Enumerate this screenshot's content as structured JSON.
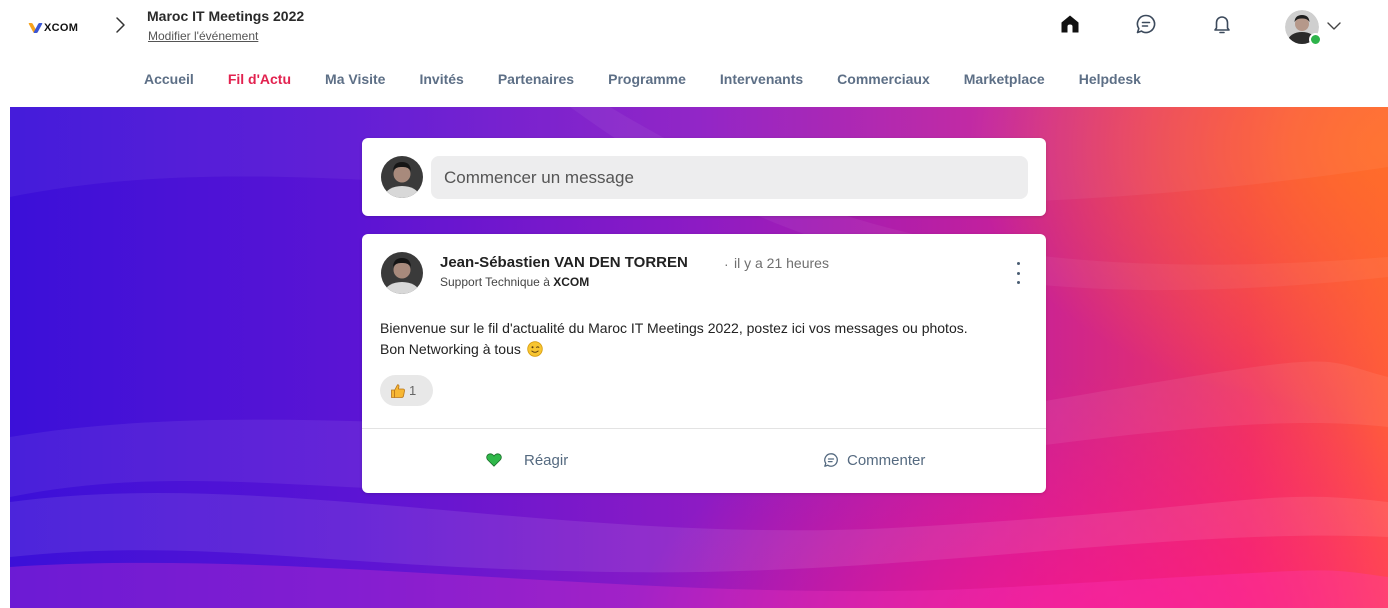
{
  "brand": {
    "logo_text": "XCOM"
  },
  "event": {
    "title": "Maroc IT Meetings 2022",
    "edit_link": "Modifier l'événement"
  },
  "nav": {
    "items": [
      {
        "label": "Accueil",
        "active": false
      },
      {
        "label": "Fil d'Actu",
        "active": true
      },
      {
        "label": "Ma Visite",
        "active": false
      },
      {
        "label": "Invités",
        "active": false
      },
      {
        "label": "Partenaires",
        "active": false
      },
      {
        "label": "Programme",
        "active": false
      },
      {
        "label": "Intervenants",
        "active": false
      },
      {
        "label": "Commerciaux",
        "active": false
      },
      {
        "label": "Marketplace",
        "active": false
      },
      {
        "label": "Helpdesk",
        "active": false
      }
    ]
  },
  "composer": {
    "placeholder": "Commencer un message"
  },
  "post": {
    "author": "Jean-Sébastien VAN DEN TORREN",
    "separator": "·",
    "time": "il y a 21 heures",
    "role_prefix": "Support Technique à",
    "company": "XCOM",
    "body_line1": "Bienvenue sur le fil d'actualité du Maroc IT Meetings 2022, postez ici vos messages ou photos.",
    "body_line2": "Bon Networking à tous",
    "reaction_count": "1",
    "react_label": "Réagir",
    "comment_label": "Commenter"
  },
  "colors": {
    "nav_active": "#e2224f",
    "nav_inactive": "#5d6f86",
    "online": "#2db34a",
    "react_heart": "#2fb84a",
    "action_text": "#556a80"
  },
  "icons": {
    "home": "home-icon",
    "chat": "chat-bubble-icon",
    "bell": "bell-icon",
    "more": "more-vertical-icon",
    "like": "thumbs-up-icon",
    "heart": "heart-icon",
    "comment": "comment-icon"
  }
}
